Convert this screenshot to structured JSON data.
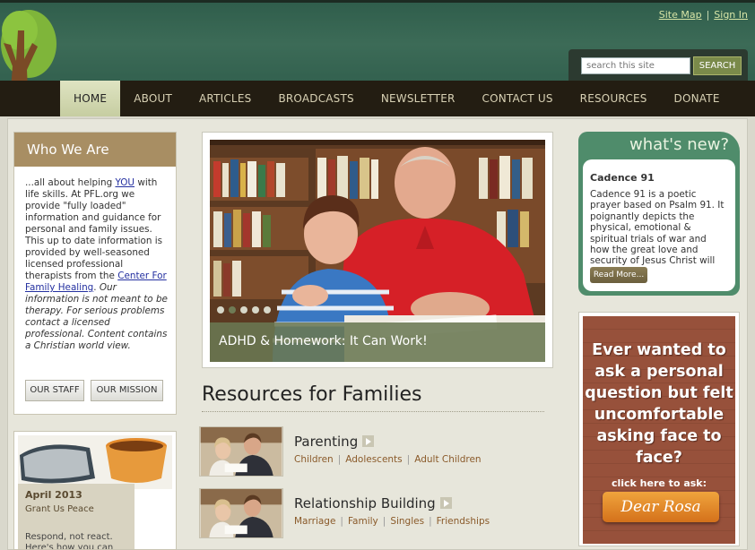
{
  "header": {
    "site_map": "Site Map",
    "sign_in": "Sign In",
    "search_placeholder": "search this site",
    "search_button": "SEARCH"
  },
  "nav": {
    "items": [
      "HOME",
      "ABOUT",
      "ARTICLES",
      "BROADCASTS",
      "NEWSLETTER",
      "CONTACT US",
      "RESOURCES",
      "DONATE"
    ],
    "active": "HOME"
  },
  "who": {
    "title": "Who We Are",
    "text_1": "...all about helping ",
    "you": "YOU",
    "text_2": " with life skills. At PFL.org we provide \"fully loaded\" information and guidance for personal and family issues. This up to date information is provided by well-seasoned licensed professional therapists from the ",
    "center_link": "Center For Family Healing",
    "text_3": ". ",
    "disclaimer": "Our information is not meant to be therapy. For serious problems contact a licensed professional. Content contains a Christian world view.",
    "staff_button": "OUR STAFF",
    "mission_button": "OUR MISSION"
  },
  "newsletter": {
    "date": "April 2013",
    "title": "Grant Us Peace",
    "teaser": "Respond, not react. Here's how you can"
  },
  "feature": {
    "caption": "ADHD & Homework: It Can Work!",
    "dot_count": 5,
    "active_dot": 2
  },
  "resources": {
    "title": "Resources for Families",
    "items": [
      {
        "name": "Parenting",
        "links": [
          "Children",
          "Adolescents",
          "Adult Children"
        ]
      },
      {
        "name": "Relationship Building",
        "links": [
          "Marriage",
          "Family",
          "Singles",
          "Friendships"
        ]
      }
    ]
  },
  "whats_new": {
    "title": "what's new?",
    "heading": "Cadence 91",
    "text": "Cadence 91 is a poetic prayer based on Psalm 91. It poignantly depicts the physical, emotional & spiritual trials of war and how the great love and security of Jesus Christ will not fail.",
    "button": "Read More..."
  },
  "rosa": {
    "question": "Ever wanted to ask a personal question but felt uncomfortable asking face to face?",
    "click": "click here to ask:",
    "button": "Dear Rosa"
  },
  "colors": {
    "header_green": "#3c6b57",
    "nav_dark": "#231d12",
    "who_title_tan": "#a88e63",
    "whats_new_green": "#4f8c6b"
  }
}
